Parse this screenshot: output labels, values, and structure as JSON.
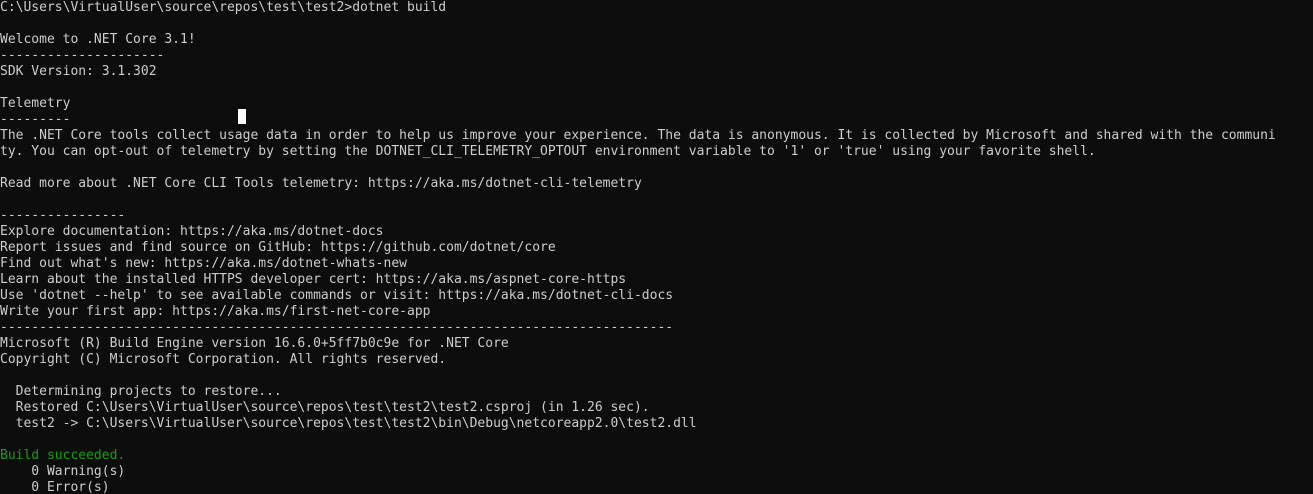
{
  "terminal": {
    "lines": {
      "prompt": "C:\\Users\\VirtualUser\\source\\repos\\test\\test2>dotnet build",
      "welcome": "Welcome to .NET Core 3.1!",
      "welcome_rule": "---------------------",
      "sdk_version": "SDK Version: 3.1.302",
      "telemetry_title": "Telemetry",
      "telemetry_rule": "---------",
      "telemetry_text_1": "The .NET Core tools collect usage data in order to help us improve your experience. The data is anonymous. It is collected by Microsoft and shared with the communi",
      "telemetry_text_2": "ty. You can opt-out of telemetry by setting the DOTNET_CLI_TELEMETRY_OPTOUT environment variable to '1' or 'true' using your favorite shell.",
      "read_more": "Read more about .NET Core CLI Tools telemetry: https://aka.ms/dotnet-cli-telemetry",
      "links_rule": "----------------",
      "docs": "Explore documentation: https://aka.ms/dotnet-docs",
      "issues": "Report issues and find source on GitHub: https://github.com/dotnet/core",
      "whats_new": "Find out what's new: https://aka.ms/dotnet-whats-new",
      "https_cert": "Learn about the installed HTTPS developer cert: https://aka.ms/aspnet-core-https",
      "help": "Use 'dotnet --help' to see available commands or visit: https://aka.ms/dotnet-cli-docs",
      "first_app": "Write your first app: https://aka.ms/first-net-core-app",
      "long_rule": "--------------------------------------------------------------------------------------",
      "msbuild": "Microsoft (R) Build Engine version 16.6.0+5ff7b0c9e for .NET Core",
      "copyright": "Copyright (C) Microsoft Corporation. All rights reserved.",
      "determining": "  Determining projects to restore...",
      "restored": "  Restored C:\\Users\\VirtualUser\\source\\repos\\test\\test2\\test2.csproj (in 1.26 sec).",
      "output_dll": "  test2 -> C:\\Users\\VirtualUser\\source\\repos\\test\\test2\\bin\\Debug\\netcoreapp2.0\\test2.dll",
      "build_succeeded": "Build succeeded.",
      "warnings": "    0 Warning(s)",
      "errors": "    0 Error(s)"
    }
  },
  "colors": {
    "background": "#0c0c0c",
    "foreground": "#cccccc",
    "success": "#13a10e",
    "cursor": "#ffffff"
  }
}
